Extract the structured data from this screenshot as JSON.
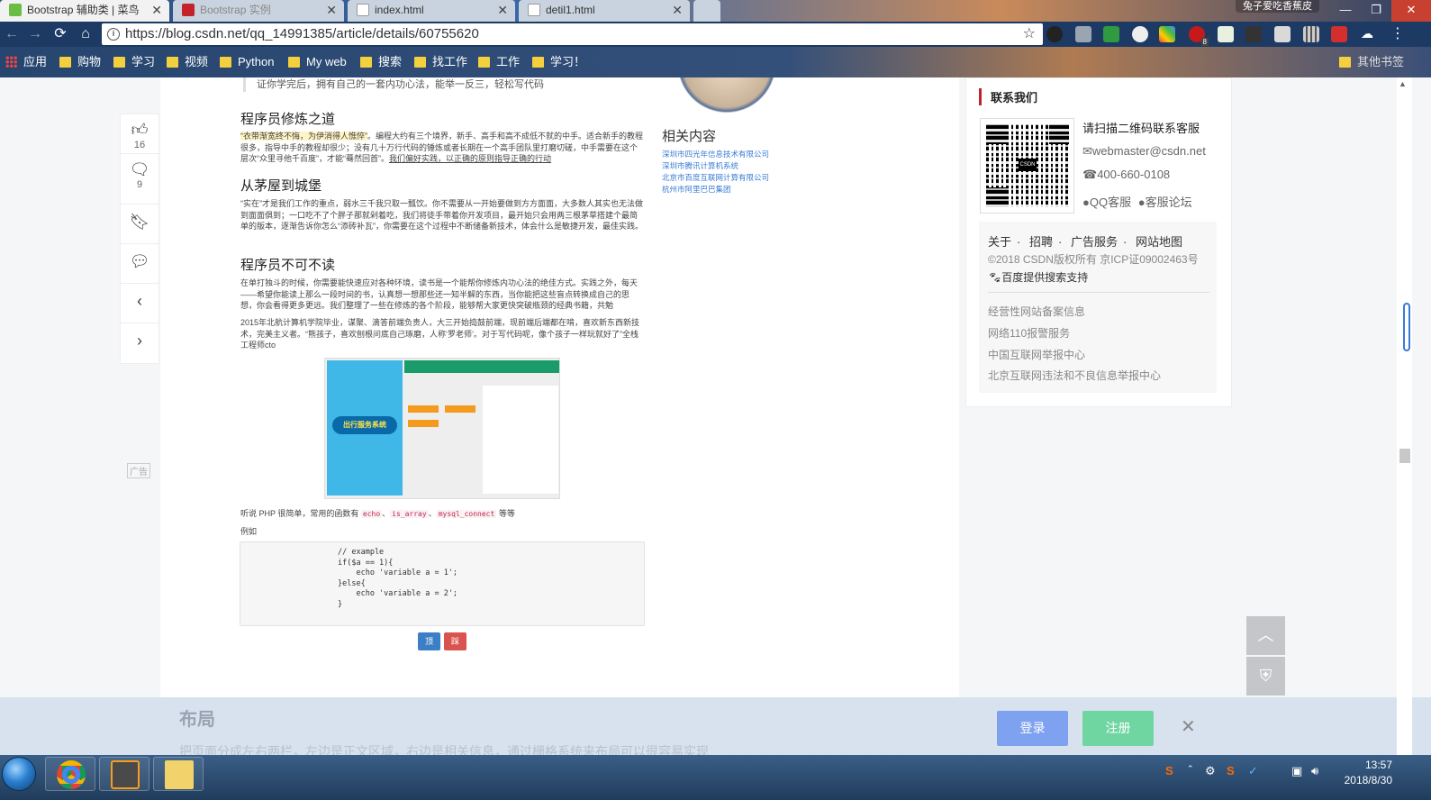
{
  "browser": {
    "tabs": [
      {
        "title": "Bootstrap 辅助类 | 菜鸟",
        "active": true
      },
      {
        "title": "Bootstrap 实例",
        "active": false
      },
      {
        "title": "index.html",
        "active": false
      },
      {
        "title": "detil1.html",
        "active": false
      }
    ],
    "profile": "兔子爱吃香蕉皮",
    "url": "https://blog.csdn.net/qq_14991385/article/details/60755620",
    "ext_abp_badge": "8",
    "bookmarks": [
      "应用",
      "购物",
      "学习",
      "视频",
      "Python",
      "My web",
      "搜索",
      "找工作",
      "工作",
      "学习！"
    ],
    "other_bookmarks": "其他书签"
  },
  "leftbar": {
    "like_count": "16",
    "comment_count": "9",
    "ad_label": "广告"
  },
  "article": {
    "quote": "证你学完后，拥有自己的一套内功心法，能举一反三，轻松写代码",
    "h_way": "程序员修炼之道",
    "p_way_hl": "“衣带渐宽终不悔，为伊消得人憔悴”",
    "p_way": "。编程大约有三个境界，新手、高手和高不成低不就的中手。适合新手的教程很多，指导中手的教程却很少；没有几十万行代码的锤炼或者长期在一个高手团队里打磨切磋，中手需要在这个层次“众里寻他千百度”，才能“蓦然回首”。",
    "p_way_ul": "我们偏好实践，以正确的原则指导正确的行动",
    "h_castle": "从茅屋到城堡",
    "p_castle": "“实在”才是我们工作的重点，弱水三千我只取一瓢饮。你不需要从一开始要做到方方面面，大多数人其实也无法做到面面俱到；一口吃不了个胖子那就剁着吃，我们将徒手带着你开发项目，最开始只会用两三根茅草搭建个最简单的版本，逐渐告诉你怎么“添砖补瓦”，你需要在这个过程中不断储备新技术，体会什么是敏捷开发，最佳实践。",
    "h_read": "程序员不可不读",
    "p_read": "在单打独斗的时候，你需要能快速应对各种环境，读书是一个能帮你修炼内功心法的绝佳方式。实践之外，每天——希望你能读上那么一段时间的书，认真想一想那些还一知半解的东西，当你能把这些盲点转换成自己的思想，你会看得更多更远。我们整理了一些在修炼的各个阶段，能够帮大家更快突破瓶颈的经典书籍，共勉",
    "p_author": "2015年北航计算机学院毕业，谋聚、滴答前端负责人，大三开始捣鼓前端，现前端后端都在啃，喜欢新东西新技术，完美主义者。“熊孩子，喜欢刨根问底自己琢磨，人称‘罗老师’。对于写代码呢，像个孩子一样玩就好了”全栈工程师cto",
    "img_brand": "出行服务系统",
    "php_prefix": "听说 PHP 很简单，常用的函数有",
    "php_codes": [
      "echo",
      "is_array",
      "mysql_connect"
    ],
    "php_sep": "、",
    "php_suffix": "等等",
    "example": "例如",
    "code": "// example\nif($a == 1){\n    echo 'variable a = 1';\n}else{\n    echo 'variable a = 2';\n}",
    "vote_up": "顶",
    "vote_down": "踩"
  },
  "related": {
    "title": "相关内容",
    "links": [
      "深圳市四光年信息技术有限公司",
      "深圳市腾讯计算机系统",
      "北京市百度互联网计算有限公司",
      "杭州市阿里巴巴集团"
    ]
  },
  "contact": {
    "title": "联系我们",
    "qr_logo": "CSDN",
    "scan": "请扫描二维码联系客服",
    "email": "webmaster@csdn.net",
    "phone": "400-660-0108",
    "qq": "QQ客服",
    "forum": "客服论坛",
    "links": [
      "关于",
      "招聘",
      "广告服务",
      "网站地图"
    ],
    "copyright": "©2018 CSDN版权所有 京ICP证09002463号",
    "baidu": "百度提供搜索支持",
    "legal": [
      "经营性网站备案信息",
      "网络110报警服务",
      "中国互联网举报中心",
      "北京互联网违法和不良信息举报中心"
    ]
  },
  "loginbar": {
    "faded_title": "布局",
    "faded_text": "把页面分成左右两栏，左边是正文区域，右边是相关信息，通过栅格系统来布局可以很容易实现",
    "login": "登录",
    "register": "注册"
  },
  "taskbar": {
    "time": "13:57",
    "date": "2018/8/30"
  }
}
